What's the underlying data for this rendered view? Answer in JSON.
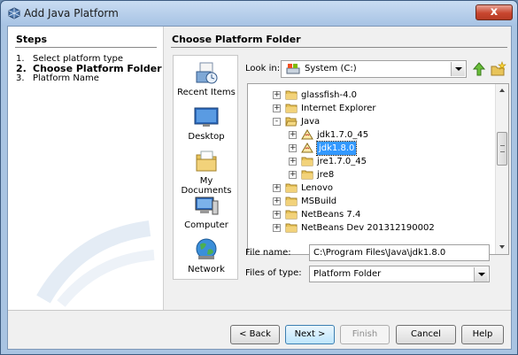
{
  "window": {
    "title": "Add Java Platform",
    "close_label": "x"
  },
  "steps": {
    "title": "Steps",
    "items": [
      {
        "num": "1.",
        "label": "Select platform type"
      },
      {
        "num": "2.",
        "label": "Choose Platform Folder"
      },
      {
        "num": "3.",
        "label": "Platform Name"
      }
    ]
  },
  "main": {
    "title": "Choose Platform Folder"
  },
  "places": [
    {
      "label": "Recent Items",
      "icon": "recent-items-icon"
    },
    {
      "label": "Desktop",
      "icon": "desktop-icon"
    },
    {
      "label": "My Documents",
      "icon": "my-documents-icon"
    },
    {
      "label": "Computer",
      "icon": "computer-icon"
    },
    {
      "label": "Network",
      "icon": "network-icon"
    }
  ],
  "lookin": {
    "label": "Look in:",
    "value": "System (C:)"
  },
  "tree": [
    {
      "label": "glassfish-4.0",
      "icon": "folder-icon",
      "expander": "+"
    },
    {
      "label": "Internet Explorer",
      "icon": "folder-icon",
      "expander": "+"
    },
    {
      "label": "Java",
      "icon": "folder-open-icon",
      "expander": "-"
    },
    {
      "label": "jdk1.7.0_45",
      "icon": "java-platform-icon",
      "expander": "+"
    },
    {
      "label": "jdk1.8.0",
      "icon": "java-platform-icon",
      "expander": "+",
      "selected": true
    },
    {
      "label": "jre1.7.0_45",
      "icon": "folder-icon",
      "expander": "+"
    },
    {
      "label": "jre8",
      "icon": "folder-icon",
      "expander": "+"
    },
    {
      "label": "Lenovo",
      "icon": "folder-icon",
      "expander": "+"
    },
    {
      "label": "MSBuild",
      "icon": "folder-icon",
      "expander": "+"
    },
    {
      "label": "NetBeans 7.4",
      "icon": "folder-icon",
      "expander": "+"
    },
    {
      "label": "NetBeans Dev 201312190002",
      "icon": "folder-icon",
      "expander": "+"
    }
  ],
  "file_name": {
    "label": "File name:",
    "value": "C:\\Program Files\\Java\\jdk1.8.0"
  },
  "files_of_type": {
    "label": "Files of type:",
    "value": "Platform Folder"
  },
  "buttons": {
    "back": "< Back",
    "next": "Next >",
    "finish": "Finish",
    "cancel": "Cancel",
    "help": "Help"
  },
  "colors": {
    "selection": "#3399ff",
    "title_bar": "#a7c3e4",
    "close_button": "#c8462f",
    "folder": "#e8c45a"
  }
}
